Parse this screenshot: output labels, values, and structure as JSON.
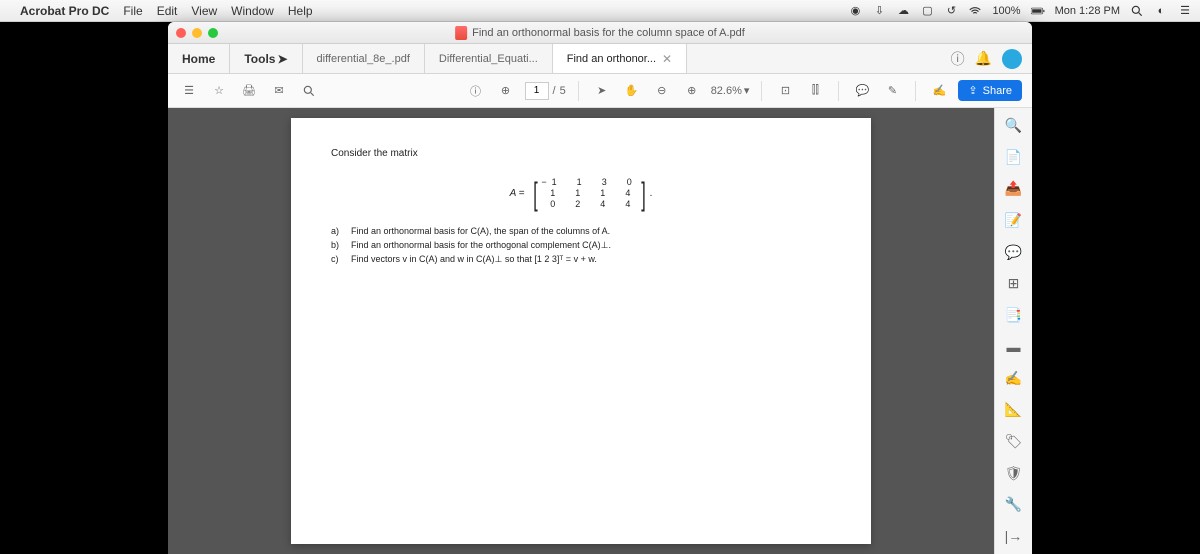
{
  "menubar": {
    "app": "Acrobat Pro DC",
    "items": [
      "File",
      "Edit",
      "View",
      "Window",
      "Help"
    ],
    "battery": "100%",
    "clock": "Mon 1:28 PM"
  },
  "window": {
    "title": "Find an orthonormal basis for the column space of A.pdf"
  },
  "tabs": {
    "home": "Home",
    "tools": "Tools",
    "docs": [
      {
        "label": "differential_8e_.pdf"
      },
      {
        "label": "Differential_Equati..."
      },
      {
        "label": "Find an orthonor...",
        "active": true
      }
    ]
  },
  "toolbar": {
    "page_current": "1",
    "page_sep": "/",
    "page_total": "5",
    "zoom": "82.6%",
    "share": "Share"
  },
  "document": {
    "heading": "Consider the matrix",
    "matrix_label": "A =",
    "matrix_rows": [
      "−1  1  3  0",
      " 1  1  1  4",
      " 0  2  4  4"
    ],
    "questions": [
      {
        "l": "a)",
        "t": "Find an orthonormal basis for C(A), the span of the columns of A."
      },
      {
        "l": "b)",
        "t": "Find an orthonormal basis for the orthogonal complement C(A)⊥."
      },
      {
        "l": "c)",
        "t": "Find vectors v in C(A) and w in C(A)⊥ so that [1  2  3]ᵀ = v + w."
      }
    ]
  }
}
